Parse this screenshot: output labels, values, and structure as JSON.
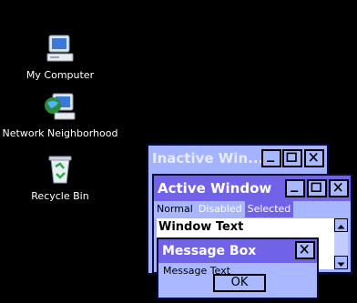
{
  "desktop": {
    "icons": [
      {
        "label": "My Computer",
        "icon": "my-computer-icon"
      },
      {
        "label": "Network Neighborhood",
        "icon": "network-neighborhood-icon"
      },
      {
        "label": "Recycle Bin",
        "icon": "recycle-bin-icon"
      }
    ],
    "background_color": "#000000"
  },
  "inactive_window": {
    "title": "Inactive Win...",
    "buttons": [
      "minimize",
      "maximize",
      "close"
    ]
  },
  "active_window": {
    "title": "Active Window",
    "buttons": [
      "minimize",
      "maximize",
      "close"
    ],
    "menu": {
      "normal": "Normal",
      "disabled": "Disabled",
      "selected": "Selected"
    },
    "window_text": "Window Text"
  },
  "message_box": {
    "title": "Message Box",
    "message": "Message Text",
    "ok_label": "OK"
  },
  "colors": {
    "active_title": "#7163e8",
    "inactive_title": "#a3b3ff",
    "window_face": "#a8b8ff",
    "selected": "#7163e8"
  }
}
